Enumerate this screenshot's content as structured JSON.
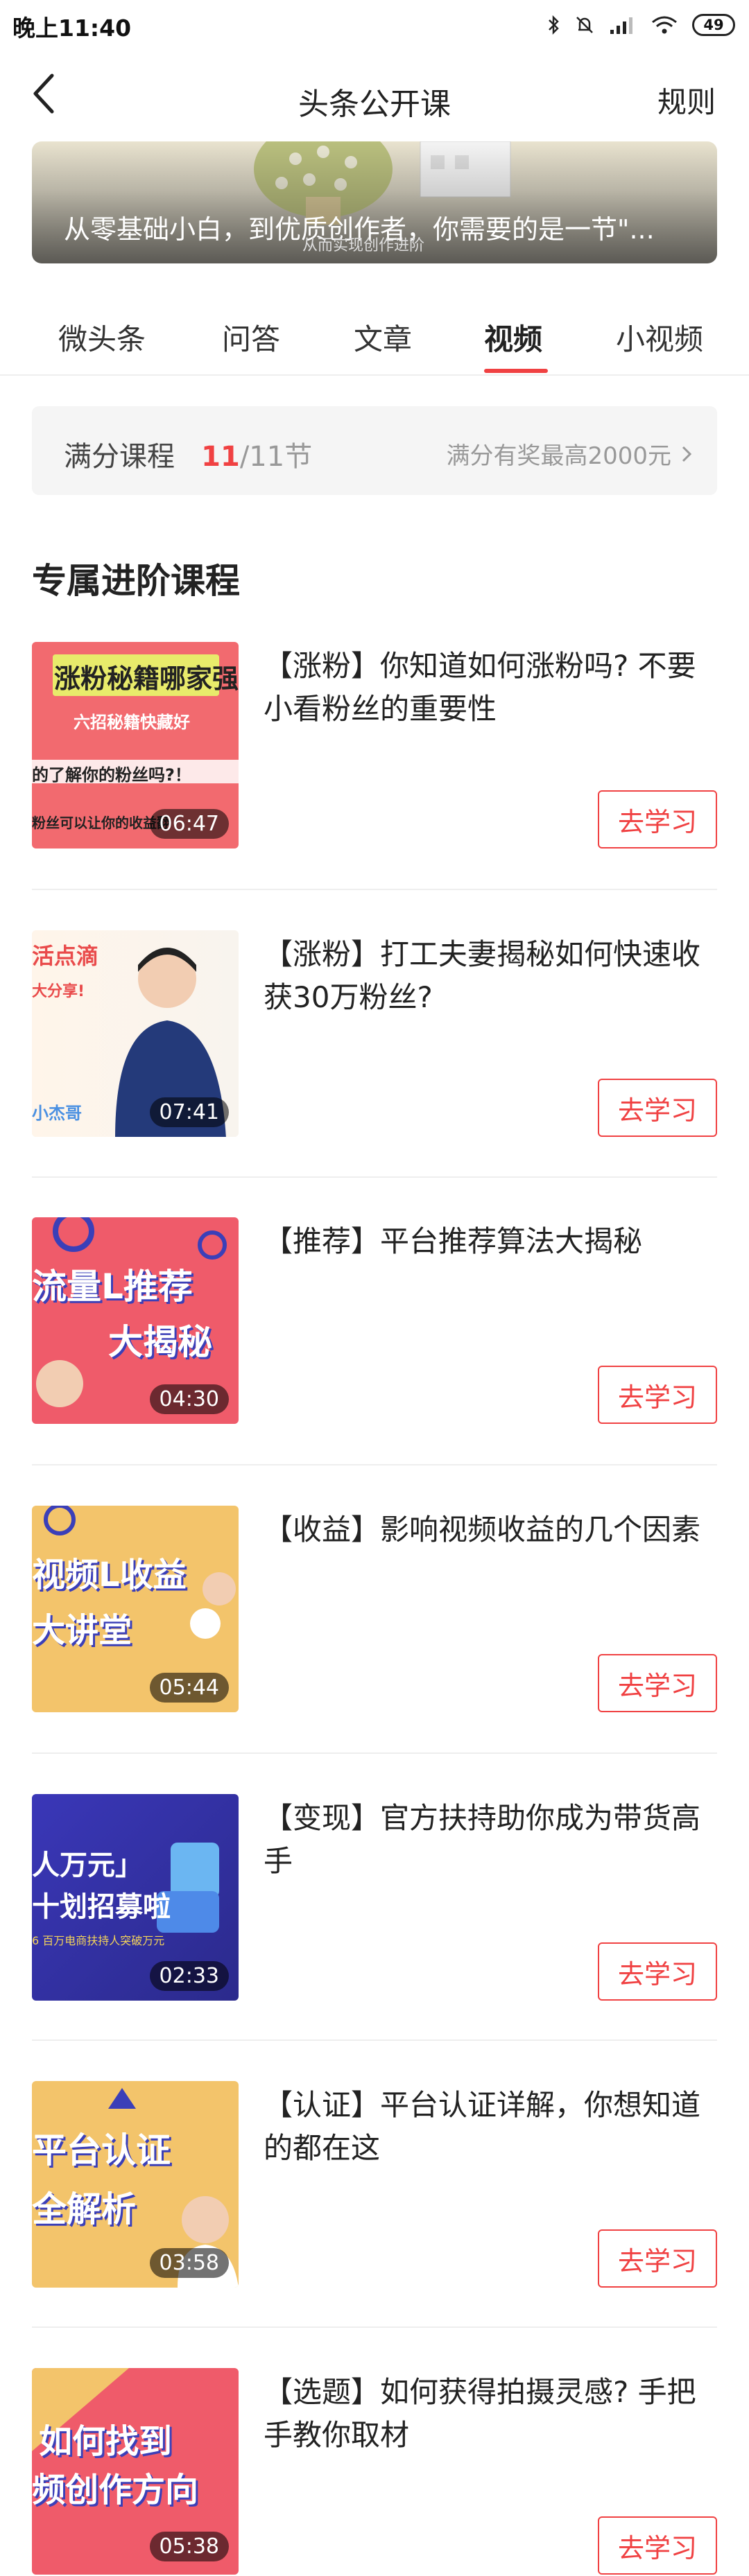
{
  "status_bar": {
    "time": "晚上11:40",
    "battery": "49"
  },
  "header": {
    "title": "头条公开课",
    "rules": "规则"
  },
  "banner": {
    "caption": "从零基础小白，到优质创作者，你需要的是一节\"...",
    "small_text": "从而实现创作进阶"
  },
  "tabs": [
    {
      "label": "微头条",
      "active": false
    },
    {
      "label": "问答",
      "active": false
    },
    {
      "label": "文章",
      "active": false
    },
    {
      "label": "视频",
      "active": true
    },
    {
      "label": "小视频",
      "active": false
    }
  ],
  "score": {
    "label": "满分课程",
    "done": "11",
    "total": "/11节",
    "reward": "满分有奖最高2000元"
  },
  "section_title": "专属进阶课程",
  "courses": [
    {
      "title": "【涨粉】你知道如何涨粉吗? 不要小看粉丝的重要性",
      "duration": "06:47",
      "button": "去学习",
      "thumb_lines": [
        "涨粉秘籍哪家强",
        "六招秘籍快藏好",
        "的了解你的粉丝吗?！",
        "粉丝可以让你的收益翻"
      ]
    },
    {
      "title": "【涨粉】打工夫妻揭秘如何快速收获30万粉丝?",
      "duration": "07:41",
      "button": "去学习",
      "thumb_lines": [
        "活点滴",
        "大分享!",
        "小杰哥"
      ]
    },
    {
      "title": "【推荐】平台推荐算法大揭秘",
      "duration": "04:30",
      "button": "去学习",
      "thumb_lines": [
        "流量L推荐",
        "大揭秘"
      ]
    },
    {
      "title": "【收益】影响视频收益的几个因素",
      "duration": "05:44",
      "button": "去学习",
      "thumb_lines": [
        "视频L收益",
        "大讲堂"
      ]
    },
    {
      "title": "【变现】官方扶持助你成为带货高手",
      "duration": "02:33",
      "button": "去学习",
      "thumb_lines": [
        "人万元」",
        "十划招募啦",
        "6 百万电商扶持人突破万元"
      ]
    },
    {
      "title": "【认证】平台认证详解，你想知道的都在这",
      "duration": "03:58",
      "button": "去学习",
      "thumb_lines": [
        "平台认证",
        "全解析"
      ]
    },
    {
      "title": "【选题】如何获得拍摄灵感? 手把手教你取材",
      "duration": "05:38",
      "button": "去学习",
      "thumb_lines": [
        "如何找到",
        "频创作方向"
      ]
    }
  ],
  "colors": {
    "accent": "#f04142",
    "muted": "#999999"
  }
}
